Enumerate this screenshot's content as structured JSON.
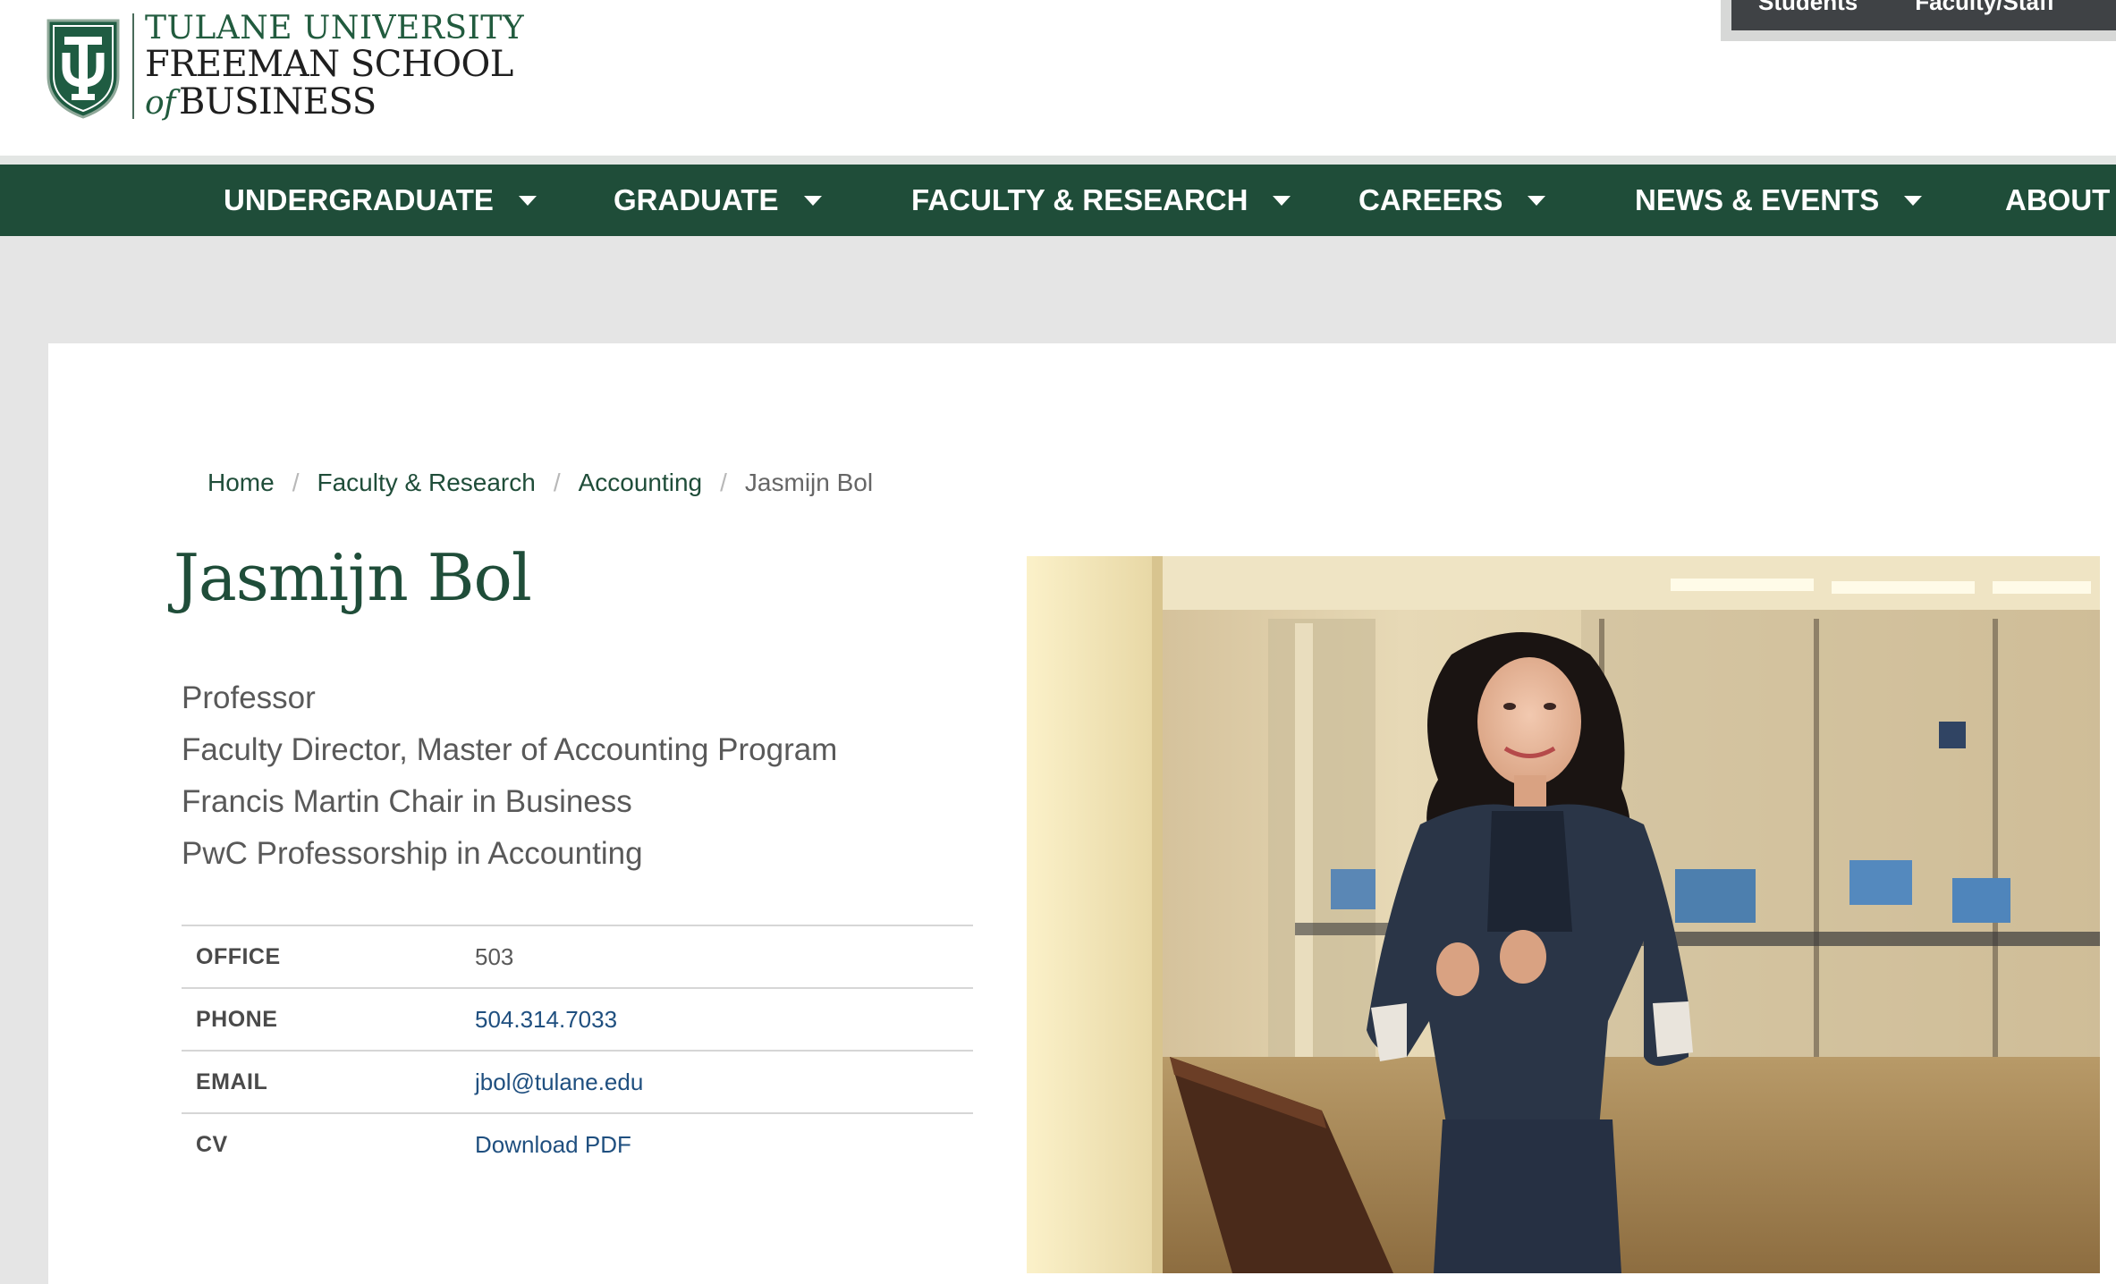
{
  "header": {
    "logo": {
      "line1": "TULANE UNIVERSITY",
      "line2": "FREEMAN SCHOOL",
      "line3_of": "of",
      "line3_rest": "BUSINESS"
    },
    "utility_links": [
      "Students",
      "Faculty/Staff"
    ]
  },
  "main_nav": {
    "items": [
      {
        "label": "UNDERGRADUATE",
        "has_dropdown": true
      },
      {
        "label": "GRADUATE",
        "has_dropdown": true
      },
      {
        "label": "FACULTY & RESEARCH",
        "has_dropdown": true
      },
      {
        "label": "CAREERS",
        "has_dropdown": true
      },
      {
        "label": "NEWS & EVENTS",
        "has_dropdown": true
      },
      {
        "label": "ABOUT",
        "has_dropdown": false
      }
    ]
  },
  "breadcrumb": {
    "items": [
      {
        "label": "Home"
      },
      {
        "label": "Faculty & Research"
      },
      {
        "label": "Accounting"
      }
    ],
    "current": "Jasmijn Bol"
  },
  "profile": {
    "name": "Jasmijn Bol",
    "titles": [
      "Professor",
      "Faculty Director, Master of Accounting Program",
      "Francis Martin Chair in Business",
      "PwC Professorship in Accounting"
    ],
    "contact": {
      "office_label": "OFFICE",
      "office_value": "503",
      "phone_label": "PHONE",
      "phone_value": "504.314.7033",
      "email_label": "EMAIL",
      "email_value": "jbol@tulane.edu",
      "cv_label": "CV",
      "cv_value": "Download PDF"
    }
  },
  "colors": {
    "brand_green": "#1f4d39",
    "link_blue": "#1f4f7f",
    "text_gray": "#595959",
    "background_gray": "#e5e5e5"
  }
}
